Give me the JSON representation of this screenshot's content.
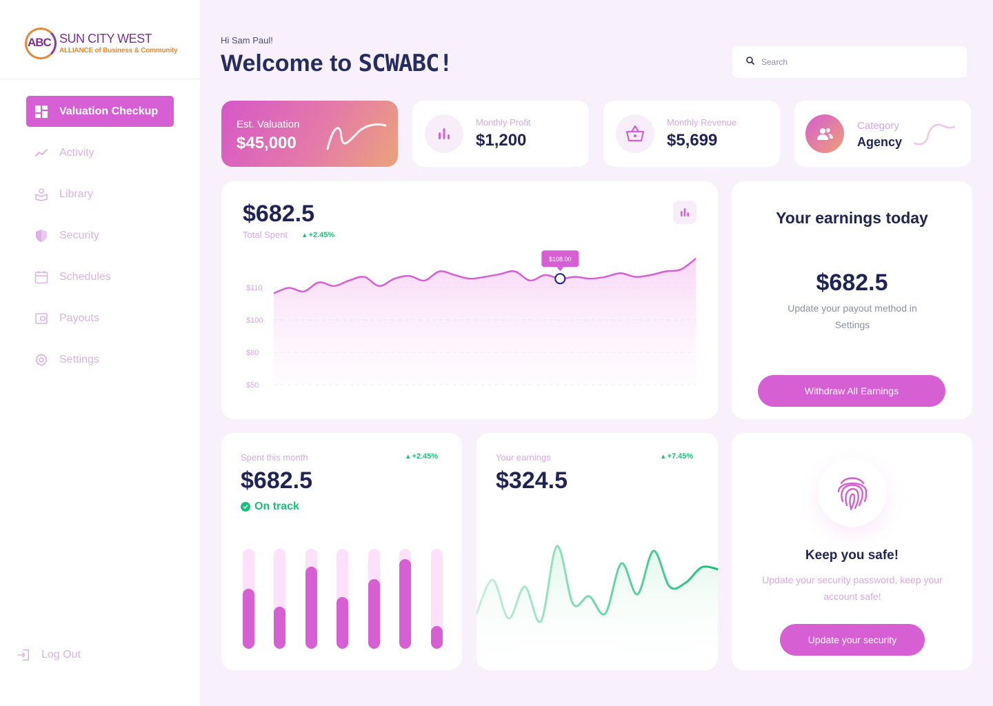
{
  "brand": {
    "logo_abc": "ABC",
    "name": "SUN CITY WEST",
    "tagline": "ALLIANCE of Business & Community"
  },
  "sidebar": {
    "items": [
      {
        "label": "Valuation Checkup",
        "icon": "dashboard-icon",
        "active": true
      },
      {
        "label": "Activity",
        "icon": "activity-icon"
      },
      {
        "label": "Library",
        "icon": "library-icon"
      },
      {
        "label": "Security",
        "icon": "shield-icon"
      },
      {
        "label": "Schedules",
        "icon": "calendar-icon"
      },
      {
        "label": "Payouts",
        "icon": "wallet-icon"
      },
      {
        "label": "Settings",
        "icon": "gear-icon"
      }
    ],
    "logout_label": "Log Out"
  },
  "header": {
    "greeting": "Hi Sam Paul!",
    "welcome": "Welcome to",
    "brand": "SCWABC!",
    "search_placeholder": "Search"
  },
  "stats": {
    "valuation": {
      "label": "Est. Valuation",
      "value": "$45,000"
    },
    "profit": {
      "label": "Monthly Profit",
      "value": "$1,200"
    },
    "revenue": {
      "label": "Monthly Revenue",
      "value": "$5,699"
    },
    "category": {
      "label": "Category",
      "value": "Agency"
    }
  },
  "total_spent": {
    "value": "$682.5",
    "label": "Total Spent",
    "delta": "+2.45%",
    "tooltip": "$108.00"
  },
  "earnings_today": {
    "title": "Your earnings today",
    "value": "$682.5",
    "text": "Update your payout method in Settings",
    "button": "Withdraw All Earnings"
  },
  "spent_month": {
    "label": "Spent this month",
    "delta": "+2.45%",
    "value": "$682.5",
    "status": "On track"
  },
  "your_earnings": {
    "label": "Your earnings",
    "delta": "+7.45%",
    "value": "$324.5"
  },
  "safety": {
    "title": "Keep you safe!",
    "text": "Update your security password, keep your account safe!",
    "button": "Update your security"
  },
  "colors": {
    "accent": "#d55fd3",
    "positive": "#1bbf7a",
    "navy": "#1e2454",
    "bg": "#f8f0fa"
  },
  "chart_data": [
    {
      "type": "area",
      "ylim": [
        50,
        116
      ],
      "y_ticks": [
        "$110",
        "$100",
        "$80",
        "$50"
      ],
      "series": [
        {
          "values": [
            100,
            103,
            101,
            106,
            104,
            107,
            109,
            104,
            108,
            109.5,
            107,
            112,
            110,
            108,
            109,
            110.5,
            112,
            107,
            110,
            108,
            109,
            108,
            109,
            111,
            109,
            110,
            112,
            113,
            119
          ]
        }
      ],
      "highlight": {
        "index": 19,
        "label": "$108.00"
      },
      "grid": true
    },
    {
      "type": "bar",
      "values": [
        0.6,
        0.42,
        0.82,
        0.52,
        0.7,
        0.9,
        0.23
      ],
      "max": 1,
      "legend": "none"
    },
    {
      "type": "line",
      "series": [
        {
          "values": [
            20,
            55,
            15,
            48,
            12,
            90,
            30,
            38,
            20,
            72,
            40,
            85,
            48,
            52,
            68,
            66
          ]
        }
      ]
    }
  ]
}
